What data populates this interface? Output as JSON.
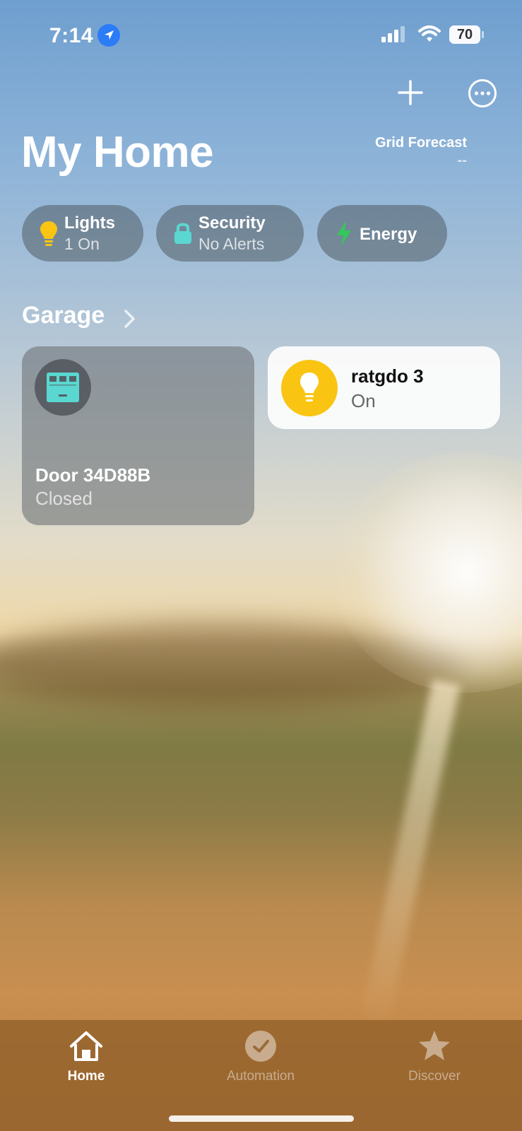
{
  "status_bar": {
    "time": "7:14",
    "battery": "70"
  },
  "header": {
    "title": "My Home",
    "forecast_label": "Grid Forecast",
    "forecast_value": "--"
  },
  "chips": [
    {
      "label": "Lights",
      "sub": "1 On",
      "icon": "lightbulb-icon",
      "color": "#f9c512"
    },
    {
      "label": "Security",
      "sub": "No Alerts",
      "icon": "lock-icon",
      "color": "#5ad7d0"
    },
    {
      "label": "Energy",
      "sub": "",
      "icon": "bolt-icon",
      "color": "#34c759"
    }
  ],
  "section": {
    "title": "Garage"
  },
  "accessories": [
    {
      "name": "Door 34D88B",
      "state": "Closed",
      "icon": "garage-door-icon",
      "icon_color": "#5ad7d0"
    },
    {
      "name": "ratgdo 3",
      "state": "On",
      "icon": "lightbulb-icon",
      "icon_color": "#f9c512"
    }
  ],
  "tabbar": {
    "tabs": [
      {
        "label": "Home",
        "icon": "house-icon",
        "selected": true
      },
      {
        "label": "Automation",
        "icon": "clock-check-icon",
        "selected": false
      },
      {
        "label": "Discover",
        "icon": "star-icon",
        "selected": false
      }
    ]
  }
}
